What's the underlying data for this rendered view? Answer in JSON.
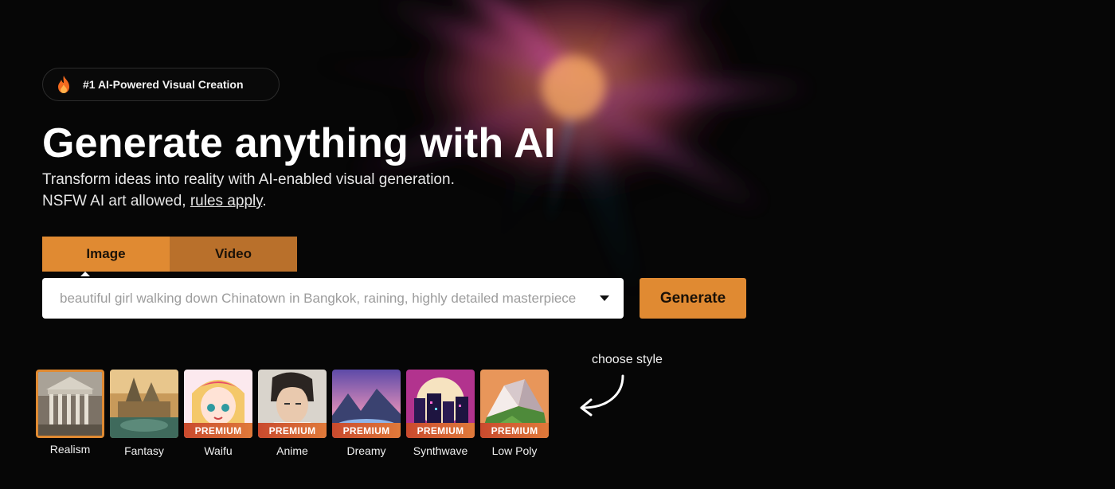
{
  "badge": {
    "text": "#1 AI-Powered Visual Creation",
    "icon": "flame-icon"
  },
  "hero": {
    "title": "Generate anything with AI",
    "subtitle_line1": "Transform ideas into reality with AI-enabled visual generation.",
    "subtitle_line2_prefix": "NSFW AI art allowed, ",
    "rules_link": "rules apply",
    "subtitle_line2_suffix": "."
  },
  "tabs": [
    {
      "label": "Image",
      "active": true
    },
    {
      "label": "Video",
      "active": false
    }
  ],
  "prompt": {
    "value": "",
    "placeholder": "beautiful girl walking down Chinatown in Bangkok, raining, highly detailed masterpiece"
  },
  "generate_label": "Generate",
  "choose_style_hint": "choose style",
  "styles": [
    {
      "label": "Realism",
      "premium": false,
      "selected": true
    },
    {
      "label": "Fantasy",
      "premium": false,
      "selected": false
    },
    {
      "label": "Waifu",
      "premium": true,
      "badge": "PREMIUM"
    },
    {
      "label": "Anime",
      "premium": true,
      "badge": "PREMIUM"
    },
    {
      "label": "Dreamy",
      "premium": true,
      "badge": "PREMIUM"
    },
    {
      "label": "Synthwave",
      "premium": true,
      "badge": "PREMIUM"
    },
    {
      "label": "Low Poly",
      "premium": true,
      "badge": "PREMIUM"
    }
  ],
  "colors": {
    "accent": "#e08a32",
    "accent_dark": "#b9702b",
    "background": "#060606",
    "premium": "#d55a33"
  }
}
